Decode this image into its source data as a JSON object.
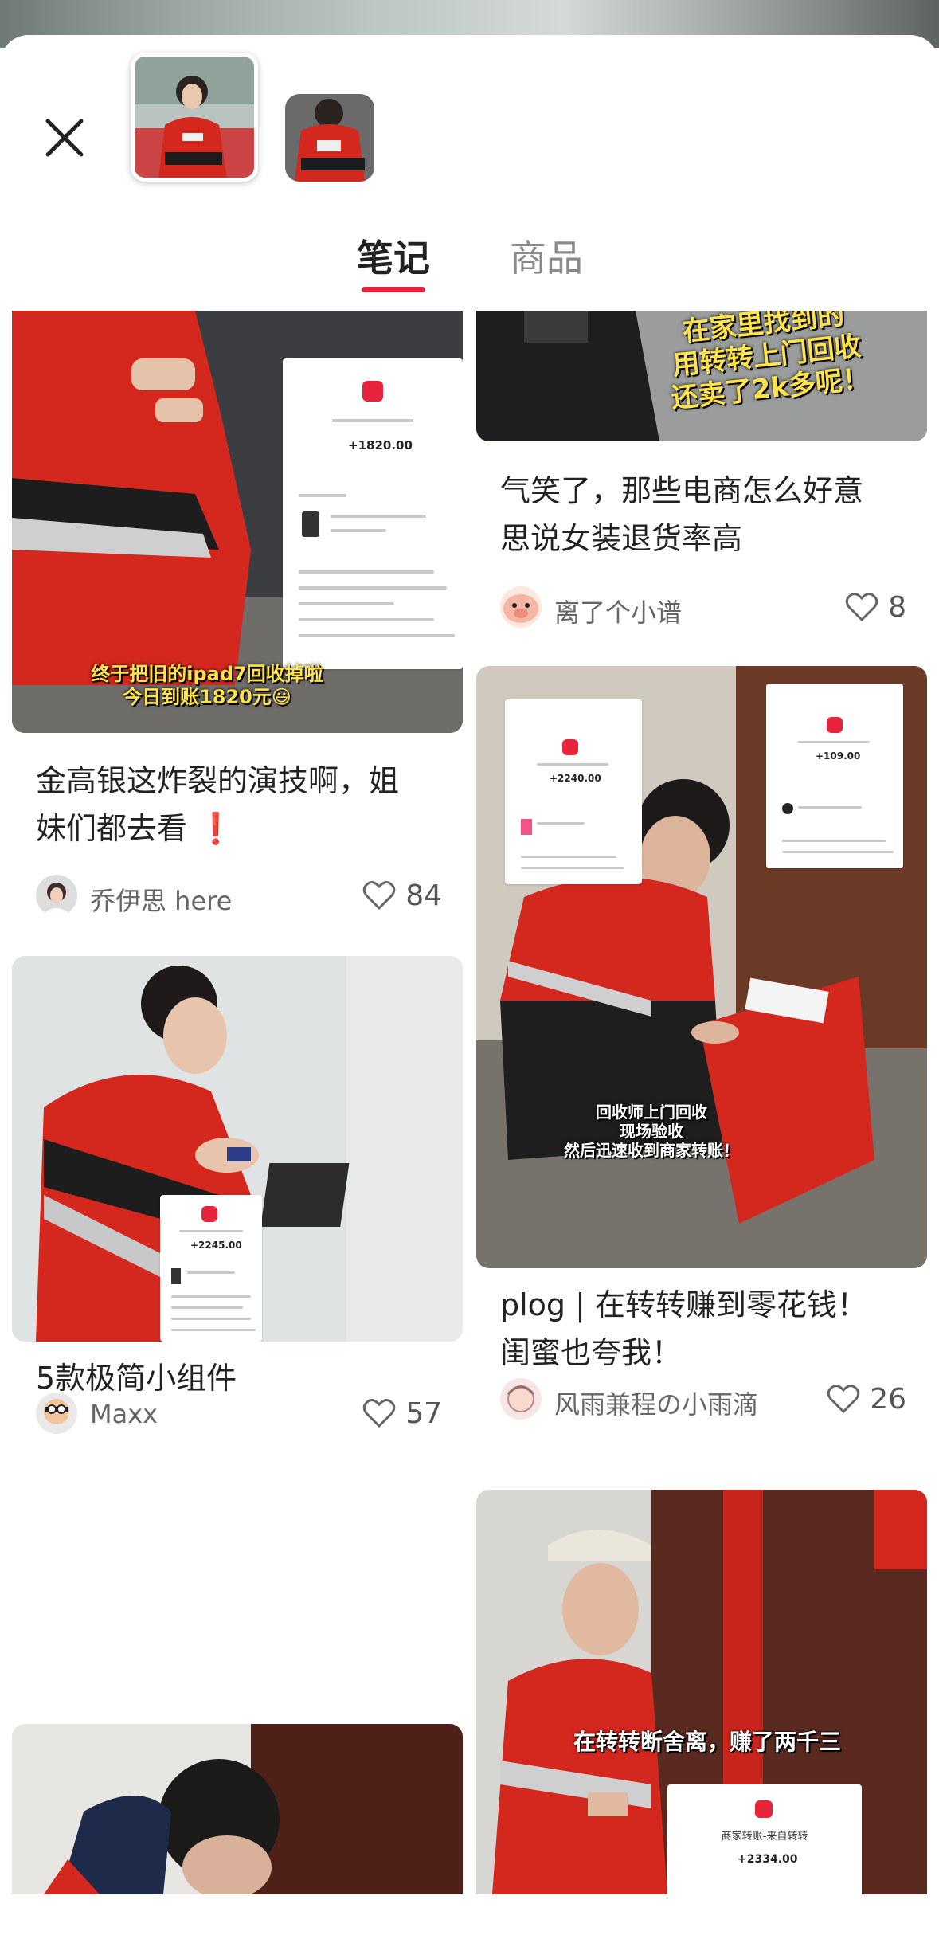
{
  "tabs": {
    "notes": "笔记",
    "products": "商品"
  },
  "cards": [
    {
      "title_lines": [
        "金高银这炸裂的演技啊，姐",
        "妹们都去看 ❗"
      ],
      "author": "乔伊思 here",
      "likes": "84",
      "overlay": [
        "终于把旧的ipad7回收掉啦",
        "今日到账1820元😃"
      ],
      "receipt_amount": "+1820.00"
    },
    {
      "title_lines": [
        "5款极简小组件"
      ],
      "author": "Maxx",
      "likes": "57",
      "receipt_amount": "+2245.00"
    },
    {
      "title_lines": [
        "气笑了，那些电商怎么好意",
        "思说女装退货率高"
      ],
      "author": "离了个小谱",
      "likes": "8",
      "overlay": [
        "在家里找到的",
        "用转转上门回收",
        "还卖了2k多呢！"
      ]
    },
    {
      "title_lines": [
        "plog | 在转转赚到零花钱！",
        "闺蜜也夸我！"
      ],
      "author": "风雨兼程の小雨滴",
      "likes": "26",
      "overlay": [
        "回收师上门回收",
        "现场验收",
        "然后迅速收到商家转账！"
      ],
      "receipt_amounts": [
        "+2240.00",
        "+109.00"
      ]
    },
    {
      "overlay": [
        "在转转断舍离，赚了两千三"
      ],
      "receipt_title": "商家转账-来自转转",
      "receipt_amount": "+2334.00"
    }
  ],
  "colors": {
    "accent": "#e8243c",
    "jacket_red": "#d4281f"
  }
}
